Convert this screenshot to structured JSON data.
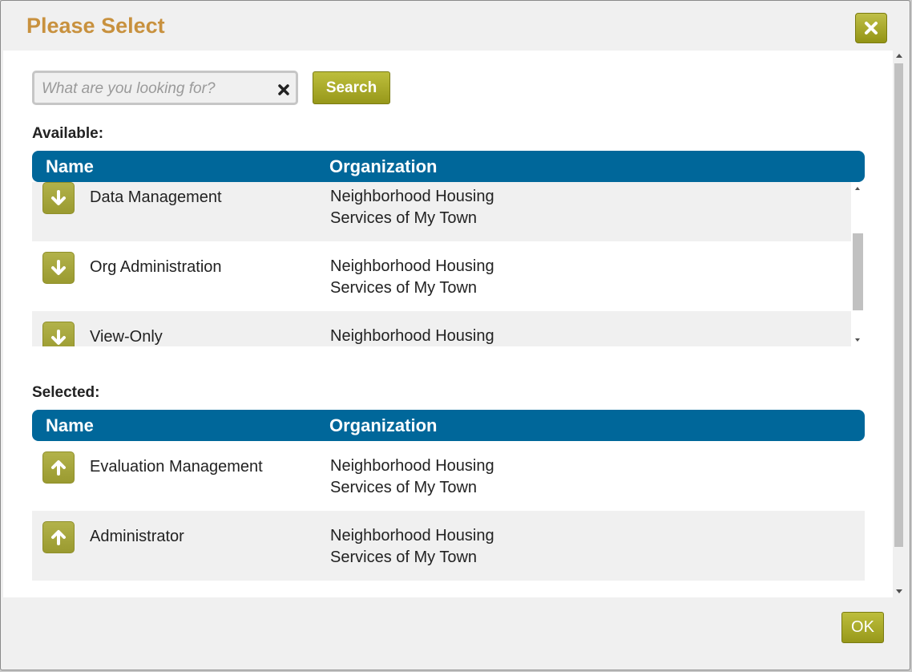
{
  "dialog": {
    "title": "Please Select",
    "close_icon": "close-icon"
  },
  "search": {
    "placeholder": "What are you looking for?",
    "value": "",
    "clear_icon": "clear-icon",
    "button_label": "Search"
  },
  "available": {
    "label": "Available:",
    "columns": {
      "name": "Name",
      "organization": "Organization"
    },
    "rows": [
      {
        "name": "Data Management",
        "org_line1": "Neighborhood Housing",
        "org_line2": "Services of My Town",
        "icon": "arrow-down-icon"
      },
      {
        "name": "Org Administration",
        "org_line1": "Neighborhood Housing",
        "org_line2": "Services of My Town",
        "icon": "arrow-down-icon"
      },
      {
        "name": "View-Only",
        "org_line1": "Neighborhood Housing",
        "org_line2": "",
        "icon": "arrow-down-icon"
      }
    ]
  },
  "selected": {
    "label": "Selected:",
    "columns": {
      "name": "Name",
      "organization": "Organization"
    },
    "rows": [
      {
        "name": "Evaluation Management",
        "org_line1": "Neighborhood Housing",
        "org_line2": "Services of My Town",
        "icon": "arrow-up-icon"
      },
      {
        "name": "Administrator",
        "org_line1": "Neighborhood Housing",
        "org_line2": "Services of My Town",
        "icon": "arrow-up-icon"
      }
    ]
  },
  "footer": {
    "ok_label": "OK"
  },
  "colors": {
    "title": "#c8913e",
    "header_bg": "#00679a",
    "button": "#a5a62a"
  }
}
